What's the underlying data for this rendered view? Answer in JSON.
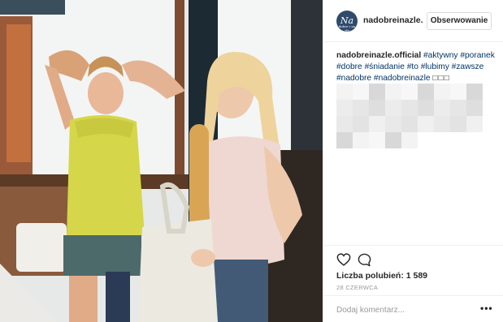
{
  "post": {
    "header": {
      "username": "nadobreinazle.",
      "avatar_text": "Na",
      "avatar_small": "dobre i na złe",
      "follow_label": "Obserwowanie"
    },
    "caption": {
      "author": "nadobreinazle.official",
      "tags": [
        "#aktywny",
        "#poranek",
        "#dobre",
        "#śniadanie",
        "#to",
        "#lubimy",
        "#zawsze",
        "#nadobre",
        "#nadobreinazle"
      ],
      "emoji_boxes": "□□□"
    },
    "likes_text": "Liczba polubień: 1 589",
    "date": "28 CZERWCA",
    "comment_placeholder": "Dodaj komentarz...",
    "more_label": "•••"
  },
  "icons": {
    "heart": "heart-icon",
    "comment": "comment-icon",
    "more": "more-options-icon"
  },
  "colors": {
    "hashtag": "#003569",
    "text": "#262626",
    "muted": "#999999",
    "border": "#efefef"
  }
}
